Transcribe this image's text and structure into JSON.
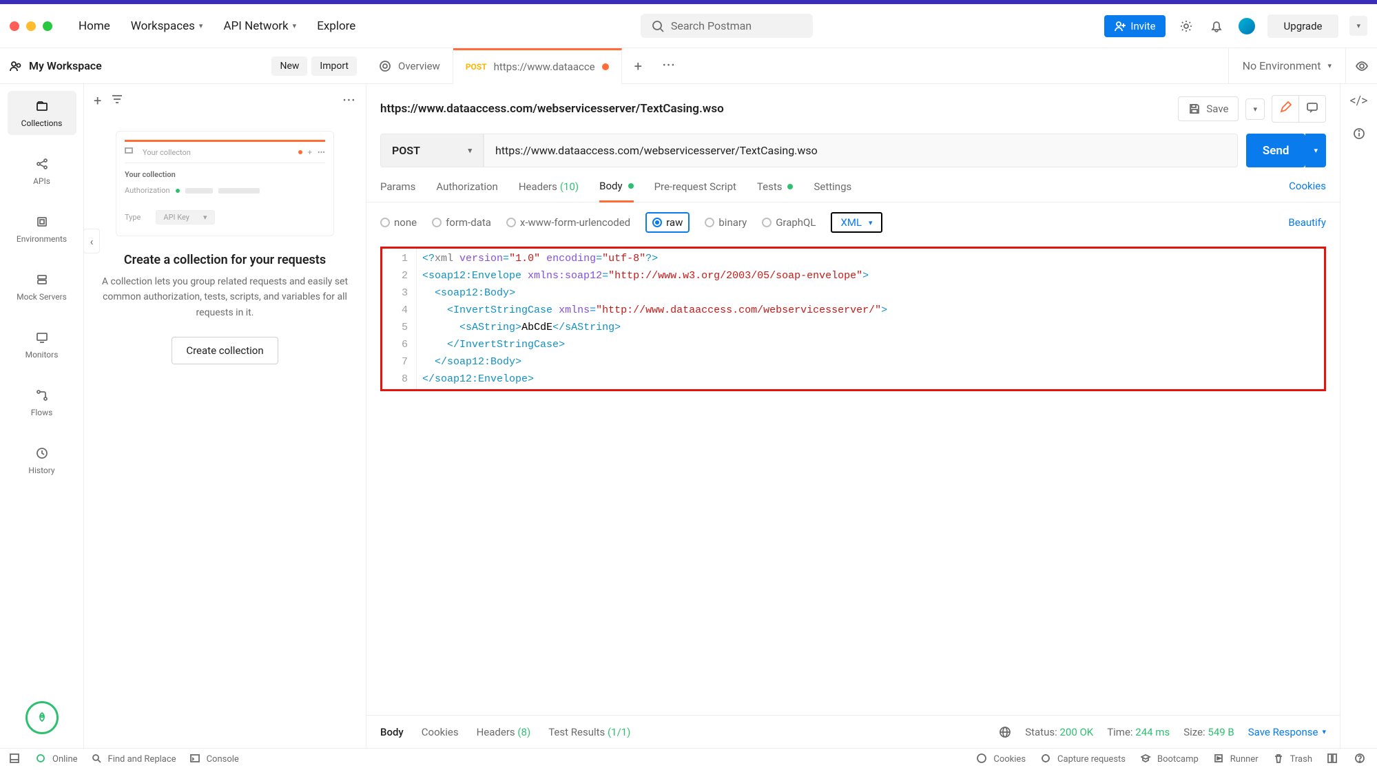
{
  "topnav": {
    "home": "Home",
    "workspaces": "Workspaces",
    "apiNetwork": "API Network",
    "explore": "Explore"
  },
  "search_placeholder": "Search Postman",
  "invite": "Invite",
  "upgrade": "Upgrade",
  "workspace": {
    "name": "My Workspace",
    "new": "New",
    "import": "Import"
  },
  "sidebar": {
    "collections": "Collections",
    "apis": "APIs",
    "environments": "Environments",
    "mock": "Mock Servers",
    "monitors": "Monitors",
    "flows": "Flows",
    "history": "History"
  },
  "sidepanel": {
    "il_tab": "Your collecton",
    "il_title": "Your collection",
    "il_auth": "Authorization",
    "il_type": "Type",
    "il_apikey": "API Key",
    "heading": "Create a collection for your requests",
    "desc": "A collection lets you group related requests and easily set common authorization, tests, scripts, and variables for all requests in it.",
    "cta": "Create collection"
  },
  "tabs": {
    "overview": "Overview",
    "req_method": "POST",
    "req_label": "https://www.dataacce",
    "env": "No Environment"
  },
  "request": {
    "title": "https://www.dataaccess.com/webservicesserver/TextCasing.wso",
    "save": "Save",
    "method": "POST",
    "url": "https://www.dataaccess.com/webservicesserver/TextCasing.wso",
    "send": "Send"
  },
  "reqtabs": {
    "params": "Params",
    "auth": "Authorization",
    "headers": "Headers",
    "headers_count": "(10)",
    "body": "Body",
    "prereq": "Pre-request Script",
    "tests": "Tests",
    "settings": "Settings",
    "cookies": "Cookies"
  },
  "bodytypes": {
    "none": "none",
    "formdata": "form-data",
    "xwww": "x-www-form-urlencoded",
    "raw": "raw",
    "binary": "binary",
    "graphql": "GraphQL",
    "xml": "XML",
    "beautify": "Beautify"
  },
  "code": {
    "l1a": "<?",
    "l1b": "xml",
    "l1c": " version",
    "l1d": "=",
    "l1e": "\"1.0\"",
    "l1f": " encoding",
    "l1g": "=",
    "l1h": "\"utf-8\"",
    "l1i": "?>",
    "l2a": "<",
    "l2b": "soap12:Envelope",
    "l2c": " xmlns:soap12",
    "l2d": "=",
    "l2e": "\"http://www.w3.org/2003/05/soap-envelope\"",
    "l2f": ">",
    "l3a": "<",
    "l3b": "soap12:Body",
    "l3c": ">",
    "l4a": "<",
    "l4b": "InvertStringCase",
    "l4c": " xmlns",
    "l4d": "=",
    "l4e": "\"http://www.dataaccess.com/webservicesserver/\"",
    "l4f": ">",
    "l5a": "<",
    "l5b": "sAString",
    "l5c": ">",
    "l5d": "AbCdE",
    "l5e": "</",
    "l5f": "sAString",
    "l5g": ">",
    "l6a": "</",
    "l6b": "InvertStringCase",
    "l6c": ">",
    "l7a": "</",
    "l7b": "soap12:Body",
    "l7c": ">",
    "l8a": "</",
    "l8b": "soap12:Envelope",
    "l8c": ">",
    "n1": "1",
    "n2": "2",
    "n3": "3",
    "n4": "4",
    "n5": "5",
    "n6": "6",
    "n7": "7",
    "n8": "8"
  },
  "response": {
    "body": "Body",
    "cookies": "Cookies",
    "headers": "Headers",
    "headers_n": "(8)",
    "testres": "Test Results",
    "testres_n": "(1/1)",
    "status_l": "Status:",
    "status_v": "200 OK",
    "time_l": "Time:",
    "time_v": "244 ms",
    "size_l": "Size:",
    "size_v": "549 B",
    "save": "Save Response"
  },
  "statusbar": {
    "online": "Online",
    "find": "Find and Replace",
    "console": "Console",
    "cookies": "Cookies",
    "capture": "Capture requests",
    "bootcamp": "Bootcamp",
    "runner": "Runner",
    "trash": "Trash"
  }
}
